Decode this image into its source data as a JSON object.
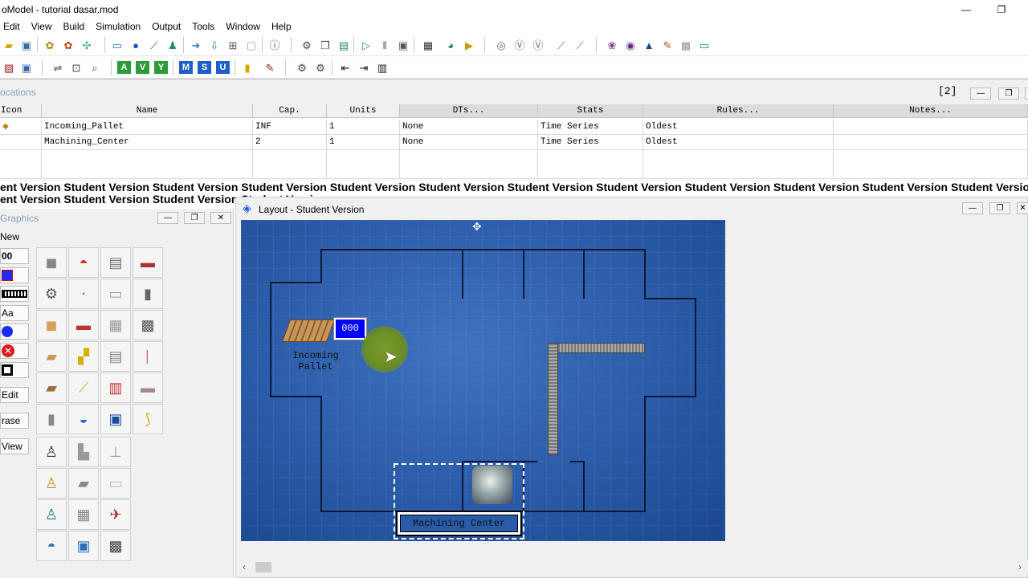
{
  "window": {
    "title": "oModel - tutorial dasar.mod",
    "minimize": "—",
    "restore": "❐"
  },
  "menu": [
    "Edit",
    "View",
    "Build",
    "Simulation",
    "Output",
    "Tools",
    "Window",
    "Help"
  ],
  "locations_panel": {
    "title": "ocations",
    "count": "[2]",
    "columns": [
      "Icon",
      "Name",
      "Cap.",
      "Units",
      "DTs...",
      "Stats",
      "Rules...",
      "Notes..."
    ],
    "rows": [
      {
        "name": "Incoming_Pallet",
        "cap": "INF",
        "units": "1",
        "dts": "None",
        "stats": "Time Series",
        "rules": "Oldest",
        "notes": ""
      },
      {
        "name": "Machining_Center",
        "cap": "2",
        "units": "1",
        "dts": "None",
        "stats": "Time Series",
        "rules": "Oldest",
        "notes": ""
      }
    ]
  },
  "watermark": {
    "line1": "ent Version Student Version Student Version Student Version Student Version Student Version Student Version Student Version Student Version Student Version Student Version Student Version",
    "line2": "ent Version Student Version Student Version Student Version"
  },
  "graphics_panel": {
    "title": "Graphics",
    "new_label": "New",
    "counter_label": "00",
    "text_label": "Aa",
    "edit_label": "Edit",
    "erase_label": "rase",
    "view_label": "View"
  },
  "layout_window": {
    "title": "Layout - Student Version",
    "counter_value": "000",
    "incoming_label_1": "Incoming",
    "incoming_label_2": "Pallet",
    "machining_label": "Machining Center"
  },
  "colors": {
    "canvas_blue": "#2a5ba8",
    "counter_blue": "#0000ff",
    "cursor_highlight": "#6b8e23"
  }
}
